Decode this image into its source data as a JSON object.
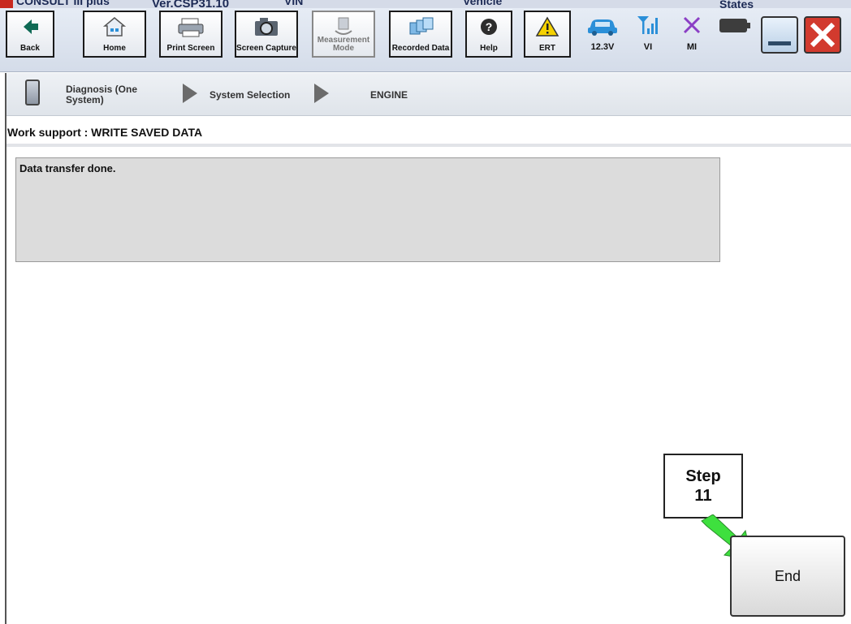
{
  "window": {
    "version": "Ver.CSP31.10",
    "title_fragment_left": "CONSULT III plus",
    "title_fragment_vin": "VIN",
    "title_fragment_vehicle": "Vehicle",
    "title_fragment_states": "States"
  },
  "toolbar": {
    "buttons": [
      {
        "label": "Back",
        "icon": "back-arrow-icon"
      },
      {
        "label": "Home",
        "icon": "home-icon"
      },
      {
        "label": "Print Screen",
        "icon": "printer-icon"
      },
      {
        "label": "Screen Capture",
        "icon": "camera-icon"
      },
      {
        "label": "Measurement Mode",
        "icon": "measurement-icon",
        "disabled": true
      },
      {
        "label": "Recorded Data",
        "icon": "recorded-data-icon"
      },
      {
        "label": "Help",
        "icon": "help-icon"
      },
      {
        "label": "ERT",
        "icon": "warning-icon"
      }
    ],
    "status": {
      "battery_voltage": "12.3V",
      "vi_label": "VI",
      "mi_label": "MI"
    },
    "colors": {
      "accent_blue": "#2b8fd8",
      "mi_purple": "#8b3fc5",
      "close_red": "#d23a2e",
      "pointer_green": "#3ee03e"
    }
  },
  "breadcrumb": {
    "items": [
      "Diagnosis (One System)",
      "System Selection",
      "ENGINE"
    ]
  },
  "main": {
    "heading": "Work support : WRITE SAVED DATA",
    "message": "Data transfer done."
  },
  "annotation": {
    "step_line1": "Step",
    "step_line2": "11"
  },
  "end_button": {
    "label": "End"
  }
}
